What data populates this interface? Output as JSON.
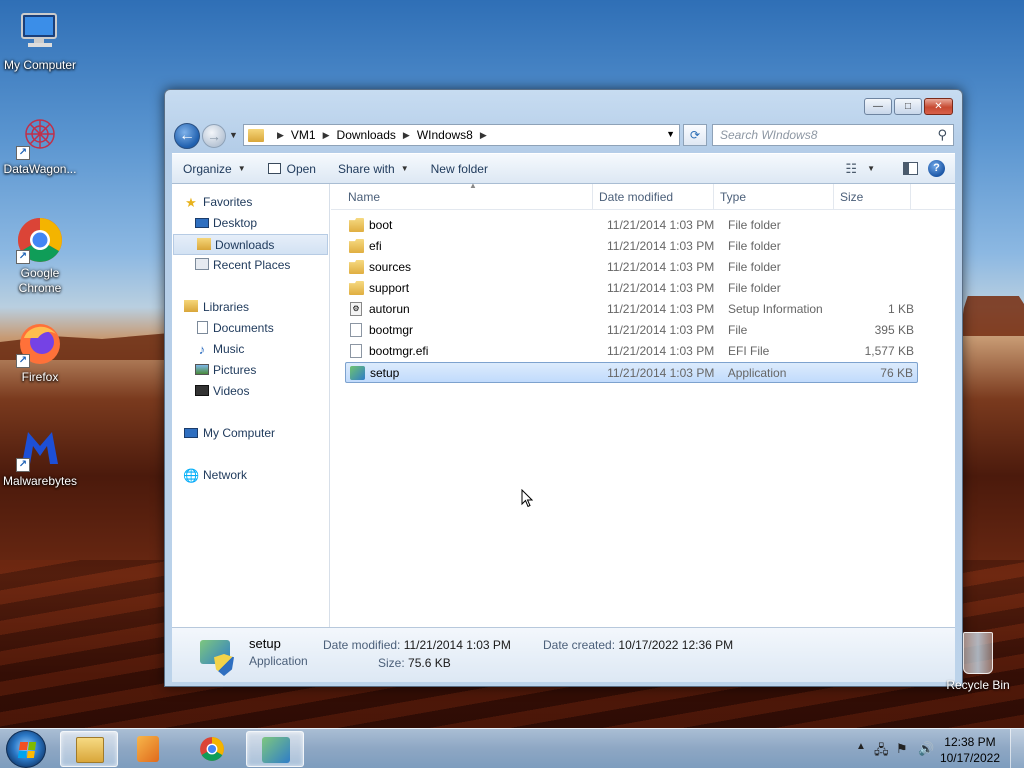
{
  "desktop": {
    "icons": [
      {
        "label": "My Computer",
        "icon": "computer-icon"
      },
      {
        "label": "DataWagon...",
        "icon": "datawagon-icon"
      },
      {
        "label": "Google Chrome",
        "icon": "chrome-icon"
      },
      {
        "label": "Firefox",
        "icon": "firefox-icon"
      },
      {
        "label": "Malwarebytes",
        "icon": "malwarebytes-icon"
      }
    ],
    "recycle_bin": "Recycle Bin"
  },
  "window": {
    "caption_buttons": {
      "minimize": "—",
      "maximize": "□",
      "close": "✕"
    },
    "address": {
      "crumbs": [
        "VM1",
        "Downloads",
        "WIndows8"
      ]
    },
    "search_placeholder": "Search WIndows8",
    "toolbar": {
      "organize": "Organize",
      "open": "Open",
      "share_with": "Share with",
      "new_folder": "New folder"
    },
    "nav": {
      "favorites": "Favorites",
      "desktop": "Desktop",
      "downloads": "Downloads",
      "recent_places": "Recent Places",
      "libraries": "Libraries",
      "documents": "Documents",
      "music": "Music",
      "pictures": "Pictures",
      "videos": "Videos",
      "my_computer": "My Computer",
      "network": "Network"
    },
    "columns": {
      "name": "Name",
      "date": "Date modified",
      "type": "Type",
      "size": "Size"
    },
    "files": [
      {
        "name": "boot",
        "date": "11/21/2014 1:03 PM",
        "type": "File folder",
        "size": "",
        "icon": "folder"
      },
      {
        "name": "efi",
        "date": "11/21/2014 1:03 PM",
        "type": "File folder",
        "size": "",
        "icon": "folder"
      },
      {
        "name": "sources",
        "date": "11/21/2014 1:03 PM",
        "type": "File folder",
        "size": "",
        "icon": "folder"
      },
      {
        "name": "support",
        "date": "11/21/2014 1:03 PM",
        "type": "File folder",
        "size": "",
        "icon": "folder"
      },
      {
        "name": "autorun",
        "date": "11/21/2014 1:03 PM",
        "type": "Setup Information",
        "size": "1 KB",
        "icon": "setupinf"
      },
      {
        "name": "bootmgr",
        "date": "11/21/2014 1:03 PM",
        "type": "File",
        "size": "395 KB",
        "icon": "file"
      },
      {
        "name": "bootmgr.efi",
        "date": "11/21/2014 1:03 PM",
        "type": "EFI File",
        "size": "1,577 KB",
        "icon": "file"
      },
      {
        "name": "setup",
        "date": "11/21/2014 1:03 PM",
        "type": "Application",
        "size": "76 KB",
        "icon": "app"
      }
    ],
    "details": {
      "name": "setup",
      "type": "Application",
      "date_modified_label": "Date modified:",
      "date_modified": "11/21/2014 1:03 PM",
      "date_created_label": "Date created:",
      "date_created": "10/17/2022 12:36 PM",
      "size_label": "Size:",
      "size": "75.6 KB"
    }
  },
  "taskbar": {
    "time": "12:38 PM",
    "date": "10/17/2022"
  },
  "colors": {
    "selection": "#c1dbfc",
    "text_nav": "#1e395b"
  }
}
